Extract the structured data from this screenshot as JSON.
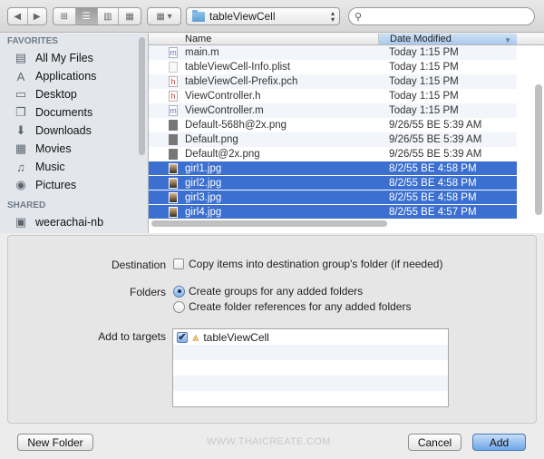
{
  "toolbar": {
    "nav": {
      "back_icon": "back-arrow-icon",
      "forward_icon": "forward-arrow-icon"
    },
    "view_modes": [
      {
        "name": "icon-view",
        "glyph": "⊞",
        "active": false
      },
      {
        "name": "list-view",
        "glyph": "☰",
        "active": true
      },
      {
        "name": "column-view",
        "glyph": "▥",
        "active": false
      },
      {
        "name": "coverflow-view",
        "glyph": "▦",
        "active": false
      }
    ],
    "arrange_glyph": "▦ ▾",
    "path_popup": {
      "value": "tableViewCell",
      "stepper": "▲▼"
    },
    "search": {
      "value": "",
      "placeholder": "",
      "icon_glyph": "🔍"
    }
  },
  "sidebar": {
    "sections": [
      {
        "title": "FAVORITES",
        "items": [
          {
            "label": "All My Files",
            "icon": "all-files-icon",
            "glyph": "▤"
          },
          {
            "label": "Applications",
            "icon": "applications-icon",
            "glyph": "A"
          },
          {
            "label": "Desktop",
            "icon": "desktop-icon",
            "glyph": "▭"
          },
          {
            "label": "Documents",
            "icon": "documents-icon",
            "glyph": "❐"
          },
          {
            "label": "Downloads",
            "icon": "downloads-icon",
            "glyph": "⬇"
          },
          {
            "label": "Movies",
            "icon": "movies-icon",
            "glyph": "▦"
          },
          {
            "label": "Music",
            "icon": "music-icon",
            "glyph": "♫"
          },
          {
            "label": "Pictures",
            "icon": "pictures-icon",
            "glyph": "◉"
          }
        ]
      },
      {
        "title": "SHARED",
        "items": [
          {
            "label": "weerachai-nb",
            "icon": "shared-computer-icon",
            "glyph": "▣"
          }
        ]
      }
    ]
  },
  "file_list": {
    "columns": {
      "name": "Name",
      "date": "Date Modified",
      "sort_glyph": "▼"
    },
    "rows": [
      {
        "name": "main.m",
        "date": "Today 1:15 PM",
        "type": "m",
        "type_glyph": "m",
        "selected": false
      },
      {
        "name": "tableViewCell-Info.plist",
        "date": "Today 1:15 PM",
        "type": "plist",
        "type_glyph": "",
        "selected": false
      },
      {
        "name": "tableViewCell-Prefix.pch",
        "date": "Today 1:15 PM",
        "type": "h",
        "type_glyph": "h",
        "selected": false
      },
      {
        "name": "ViewController.h",
        "date": "Today 1:15 PM",
        "type": "h",
        "type_glyph": "h",
        "selected": false
      },
      {
        "name": "ViewController.m",
        "date": "Today 1:15 PM",
        "type": "m",
        "type_glyph": "m",
        "selected": false
      },
      {
        "name": "Default-568h@2x.png",
        "date": "9/26/55 BE 5:39 AM",
        "type": "png",
        "type_glyph": "",
        "selected": false
      },
      {
        "name": "Default.png",
        "date": "9/26/55 BE 5:39 AM",
        "type": "png",
        "type_glyph": "",
        "selected": false
      },
      {
        "name": "Default@2x.png",
        "date": "9/26/55 BE 5:39 AM",
        "type": "png",
        "type_glyph": "",
        "selected": false
      },
      {
        "name": "girl1.jpg",
        "date": "8/2/55 BE 4:58 PM",
        "type": "jpg",
        "type_glyph": "",
        "selected": true
      },
      {
        "name": "girl2.jpg",
        "date": "8/2/55 BE 4:58 PM",
        "type": "jpg",
        "type_glyph": "",
        "selected": true
      },
      {
        "name": "girl3.jpg",
        "date": "8/2/55 BE 4:58 PM",
        "type": "jpg",
        "type_glyph": "",
        "selected": true
      },
      {
        "name": "girl4.jpg",
        "date": "8/2/55 BE 4:57 PM",
        "type": "jpg",
        "type_glyph": "",
        "selected": true
      }
    ]
  },
  "options": {
    "destination": {
      "label": "Destination",
      "checkbox_label": "Copy items into destination group's folder (if needed)",
      "checked": false
    },
    "folders": {
      "label": "Folders",
      "choices": [
        {
          "label": "Create groups for any added folders",
          "selected": true
        },
        {
          "label": "Create folder references for any added folders",
          "selected": false
        }
      ]
    },
    "targets": {
      "label": "Add to targets",
      "items": [
        {
          "label": "tableViewCell",
          "checked": true,
          "check_glyph": "✔",
          "icon_glyph": "⩓"
        }
      ]
    }
  },
  "footer": {
    "new_folder": "New Folder",
    "cancel": "Cancel",
    "add": "Add",
    "watermark": "WWW.THAICREATE.COM"
  }
}
